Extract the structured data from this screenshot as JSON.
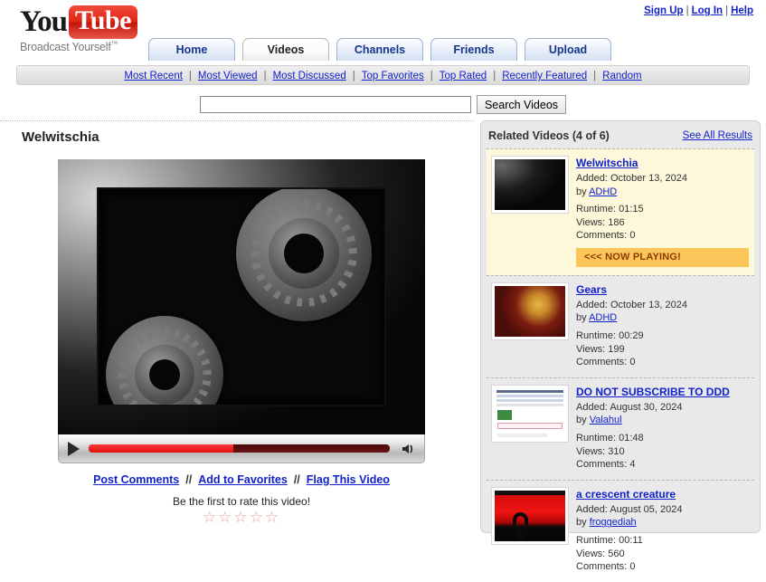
{
  "header": {
    "logo": {
      "you": "You",
      "tube": "Tube",
      "tagline": "Broadcast Yourself",
      "tm": "™"
    },
    "account_links": [
      {
        "label": "Sign Up",
        "name": "sign-up-link"
      },
      {
        "label": "Log In",
        "name": "log-in-link"
      },
      {
        "label": "Help",
        "name": "help-link"
      }
    ],
    "separator": "|"
  },
  "tabs": [
    {
      "label": "Home",
      "active": false
    },
    {
      "label": "Videos",
      "active": true
    },
    {
      "label": "Channels",
      "active": false
    },
    {
      "label": "Friends",
      "active": false
    },
    {
      "label": "Upload",
      "active": false
    }
  ],
  "subnav": {
    "separator": "|",
    "items": [
      "Most Recent",
      "Most Viewed",
      "Most Discussed",
      "Top Favorites",
      "Top Rated",
      "Recently Featured",
      "Random"
    ]
  },
  "search": {
    "value": "",
    "placeholder": "",
    "button_label": "Search Videos"
  },
  "video": {
    "title": "Welwitschia",
    "progress_percent": 48,
    "player_controls": {
      "play_label": "Play",
      "volume_label": "Volume"
    },
    "actions": [
      "Post Comments",
      "Add to Favorites",
      "Flag This Video"
    ],
    "action_separator": "//",
    "rating_prompt": "Be the first to rate this video!",
    "stars": [
      "☆",
      "☆",
      "☆",
      "☆",
      "☆"
    ]
  },
  "related": {
    "heading": "Related Videos (4 of 6)",
    "see_all_label": "See All Results",
    "labels": {
      "added": "Added:",
      "by": "by",
      "runtime": "Runtime:",
      "views": "Views:",
      "comments": "Comments:"
    },
    "now_playing_badge": "<<< NOW PLAYING!",
    "items": [
      {
        "title": "Welwitschia",
        "added": "October 13, 2024",
        "author": "ADHD",
        "runtime": "01:15",
        "views": "186",
        "comments": "0",
        "now_playing": true,
        "thumb": "th-welw"
      },
      {
        "title": "Gears",
        "added": "October 13, 2024",
        "author": "ADHD",
        "runtime": "00:29",
        "views": "199",
        "comments": "0",
        "now_playing": false,
        "thumb": "th-gears"
      },
      {
        "title": "DO NOT SUBSCRIBE TO DDD",
        "added": "August 30, 2024",
        "author": "Valahul",
        "runtime": "01:48",
        "views": "310",
        "comments": "4",
        "now_playing": false,
        "thumb": "th-ddd"
      },
      {
        "title": "a crescent creature",
        "added": "August 05, 2024",
        "author": "froggediah",
        "runtime": "00:11",
        "views": "560",
        "comments": "0",
        "now_playing": false,
        "thumb": "th-crescent"
      }
    ]
  },
  "colors": {
    "brand_red": "#e02516",
    "link_blue": "#1122cc",
    "now_playing_bg": "#fbc55a",
    "now_playing_row": "#fdf8da",
    "sidebar_bg": "#e9e9e9"
  }
}
